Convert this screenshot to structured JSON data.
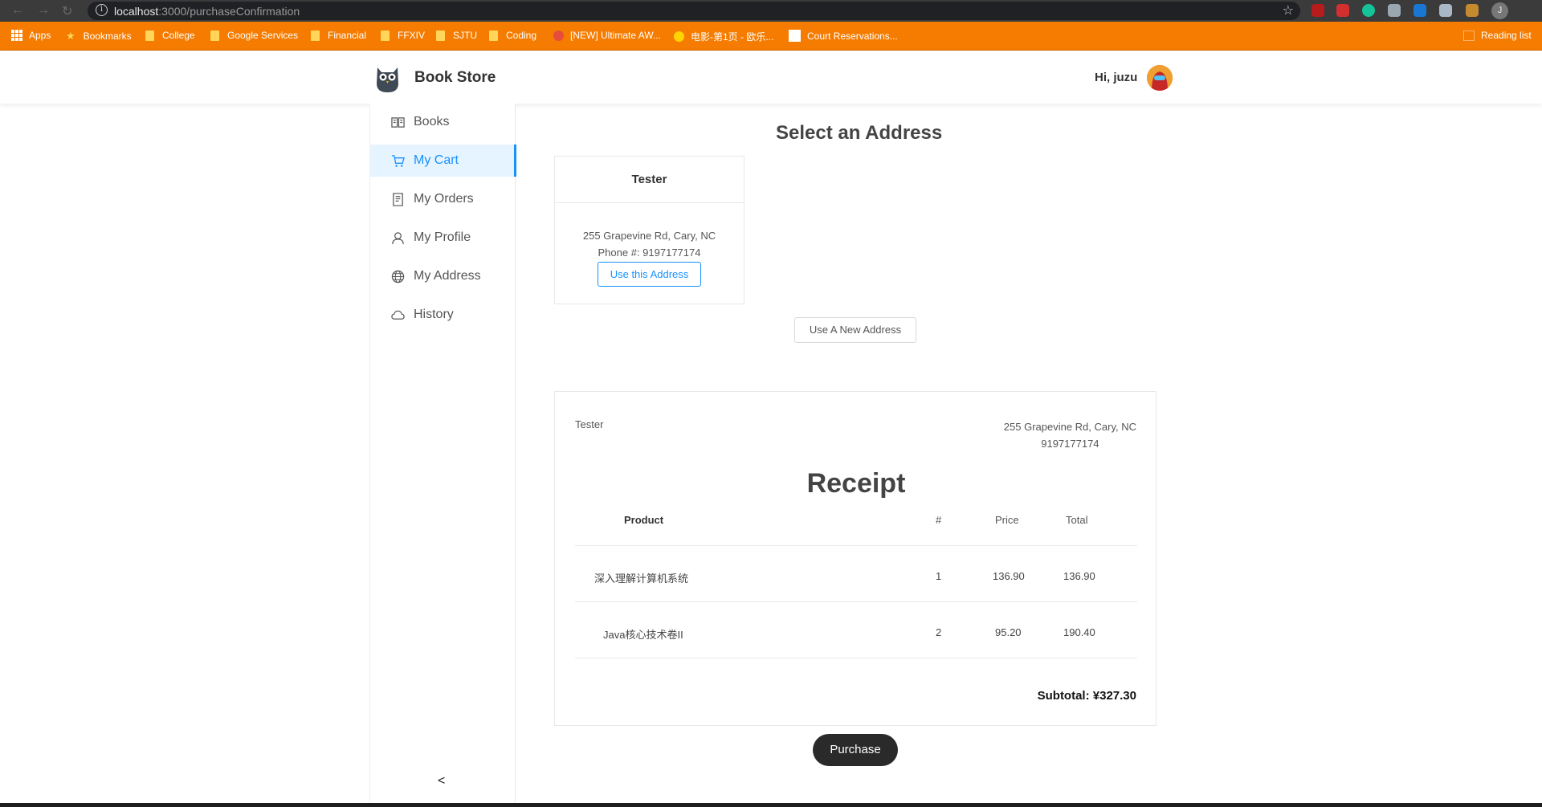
{
  "browser": {
    "url_host": "localhost",
    "url_path": ":3000/purchaseConfirmation",
    "bookmarks": [
      "Apps",
      "Bookmarks",
      "College",
      "Google Services",
      "Financial",
      "FFXIV",
      "SJTU",
      "Coding",
      "[NEW] Ultimate AW...",
      "电影-第1页 - 欧乐...",
      "Court Reservations..."
    ],
    "reading_list": "Reading list",
    "profile_initial": "J"
  },
  "header": {
    "brand": "Book Store",
    "greeting": "Hi,  juzu"
  },
  "sidebar": {
    "items": [
      {
        "label": "Books",
        "icon": "book-icon"
      },
      {
        "label": "My Cart",
        "icon": "cart-icon",
        "active": true
      },
      {
        "label": "My Orders",
        "icon": "orders-icon"
      },
      {
        "label": "My Profile",
        "icon": "user-icon"
      },
      {
        "label": "My Address",
        "icon": "globe-icon"
      },
      {
        "label": "History",
        "icon": "cloud-icon"
      }
    ],
    "collapse_glyph": "<"
  },
  "address_section": {
    "title": "Select an Address",
    "card": {
      "name": "Tester",
      "address": "255 Grapevine Rd, Cary, NC",
      "phone": "Phone #: 9197177174",
      "button": "Use this Address"
    },
    "new_address_button": "Use A New Address"
  },
  "receipt": {
    "name": "Tester",
    "address": "255 Grapevine Rd, Cary, NC",
    "phone": "9197177174",
    "title": "Receipt",
    "columns": {
      "product": "Product",
      "qty": "#",
      "price": "Price",
      "total": "Total"
    },
    "rows": [
      {
        "product": "深入理解计算机系统",
        "qty": "1",
        "price": "136.90",
        "total": "136.90"
      },
      {
        "product": "Java核心技术卷II",
        "qty": "2",
        "price": "95.20",
        "total": "190.40"
      }
    ],
    "subtotal": "Subtotal: ¥327.30"
  },
  "purchase_button": "Purchase",
  "colors": {
    "accent": "#1890ff",
    "bookmark_bar": "#f57c00",
    "dark_button": "#2a2a2a"
  }
}
